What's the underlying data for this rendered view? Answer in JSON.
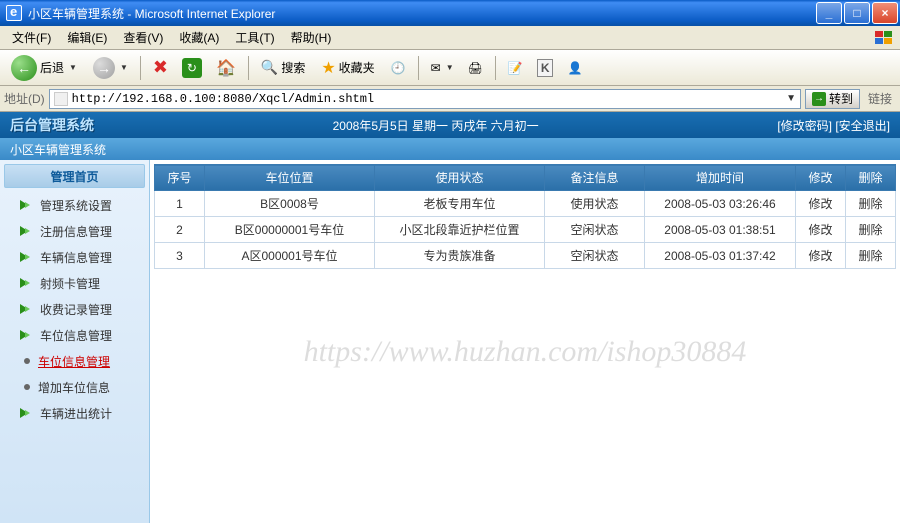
{
  "window": {
    "title": "小区车辆管理系统 - Microsoft Internet Explorer"
  },
  "menubar": {
    "file": "文件(F)",
    "edit": "编辑(E)",
    "view": "查看(V)",
    "favorites": "收藏(A)",
    "tools": "工具(T)",
    "help": "帮助(H)"
  },
  "toolbar": {
    "back": "后退",
    "search": "搜索",
    "favorites": "收藏夹"
  },
  "addressbar": {
    "label": "地址(D)",
    "url": "http://192.168.0.100:8080/Xqcl/Admin.shtml",
    "go": "转到",
    "links": "链接"
  },
  "app": {
    "logo": "后台管理系统",
    "date": "2008年5月5日 星期一 丙戌年 六月初一",
    "change_password": "[修改密码]",
    "safe_exit": "[安全退出]",
    "subtitle": "小区车辆管理系统"
  },
  "nav": {
    "home": "管理首页",
    "items": [
      "管理系统设置",
      "注册信息管理",
      "车辆信息管理",
      "射频卡管理",
      "收费记录管理",
      "车位信息管理"
    ],
    "sub_active": "车位信息管理",
    "sub_add": "增加车位信息",
    "last": "车辆进出统计"
  },
  "table": {
    "headers": {
      "seq": "序号",
      "location": "车位位置",
      "status": "使用状态",
      "note": "备注信息",
      "addtime": "增加时间",
      "edit": "修改",
      "delete": "删除"
    },
    "rows": [
      {
        "seq": "1",
        "location": "B区0008号",
        "status": "老板专用车位",
        "note": "使用状态",
        "addtime": "2008-05-03 03:26:46",
        "edit": "修改",
        "delete": "删除"
      },
      {
        "seq": "2",
        "location": "B区00000001号车位",
        "status": "小区北段靠近护栏位置",
        "note": "空闲状态",
        "addtime": "2008-05-03 01:38:51",
        "edit": "修改",
        "delete": "删除"
      },
      {
        "seq": "3",
        "location": "A区000001号车位",
        "status": "专为贵族准备",
        "note": "空闲状态",
        "addtime": "2008-05-03 01:37:42",
        "edit": "修改",
        "delete": "删除"
      }
    ]
  },
  "watermark": "https://www.huzhan.com/ishop30884"
}
